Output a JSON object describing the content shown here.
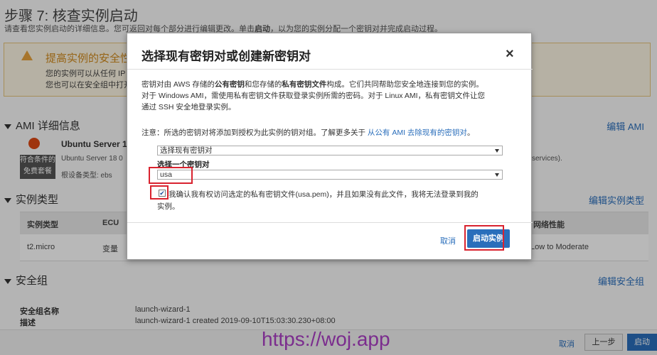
{
  "page": {
    "step_title": "步骤 7: 核查实例启动",
    "step_subtitle_pre": "请查看您实例启动的详细信息。您可返回对每个部分进行编辑更改。单击",
    "step_subtitle_bold": "启动",
    "step_subtitle_post": "，以为您的实例分配一个密钥对并完成启动过程。"
  },
  "warning": {
    "title": "提高实例的安全性",
    "line1": "您的实例可以从任何 IP",
    "line2": "您也可以在安全组中打开"
  },
  "ami": {
    "section_title": "AMI 详细信息",
    "edit_label": "编辑 AMI",
    "name": "Ubuntu Server 1",
    "badge_line1": "符合条件的",
    "badge_line2": "免费套餐",
    "description": "Ubuntu Server 18 0",
    "meta": "根设备类型: ebs",
    "right_text": "services)."
  },
  "instance_type": {
    "section_title": "实例类型",
    "edit_label": "编辑实例类型",
    "headers": [
      "实例类型",
      "ECU",
      "网络性能"
    ],
    "row": [
      "t2.micro",
      "变量",
      "Low to Moderate"
    ]
  },
  "security_group": {
    "section_title": "安全组",
    "edit_label": "编辑安全组",
    "name_label": "安全组名称",
    "name_value": "launch-wizard-1",
    "desc_label": "描述",
    "desc_value": "launch-wizard-1 created 2019-09-10T15:03:30.230+08:00"
  },
  "bottom_bar": {
    "cancel": "取消",
    "previous": "上一步",
    "launch": "启动"
  },
  "watermark": "https://woj.app",
  "modal": {
    "title": "选择现有密钥对或创建新密钥对",
    "close_glyph": "×",
    "para1_a": "密钥对由 AWS 存储的",
    "para1_b": "公有密钥",
    "para1_c": "和您存储的",
    "para1_d": "私有密钥文件",
    "para1_e": "构成。它们共同帮助您安全地连接到您的实例。",
    "para2": "对于 Windows AMI，需使用私有密钥文件获取登录实例所需的密码。对于 Linux AMI，私有密钥文件让您",
    "para3": "通过 SSH 安全地登录实例。",
    "note_pre": "注意：所选的密钥对将添加到授权为此实例的钥对组。了解更多关于",
    "note_link": "从公有 AMI 去除现有的密钥对",
    "note_post": "。",
    "select_mode_value": "选择现有密钥对",
    "select_key_label": "选择一个密钥对",
    "select_key_value": "usa",
    "ack_checked": "✔",
    "ack_line1": "我确认我有权访问选定的私有密钥文件(usa.pem)，并且如果没有此文件，我将无法登录到我的",
    "ack_line2": "实例。",
    "cancel": "取消",
    "launch": "启动实例"
  }
}
